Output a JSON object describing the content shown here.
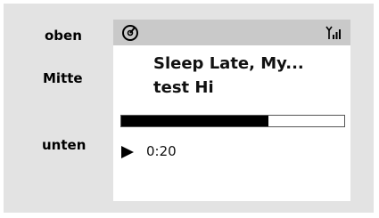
{
  "labels": {
    "top": "oben",
    "middle": "Mitte",
    "bottom": "unten"
  },
  "track": {
    "title_line1": "Sleep Late, My...",
    "title_line2": "test Hi"
  },
  "playback": {
    "progress_percent": 66,
    "elapsed": "0:20",
    "state": "playing"
  },
  "icons": {
    "source": "disc-icon",
    "signal": "signal-strength-icon",
    "play": "play-icon"
  },
  "colors": {
    "background": "#e3e3e3",
    "status_bar": "#c9c9c9",
    "screen": "#ffffff",
    "progress_fill": "#000000"
  }
}
